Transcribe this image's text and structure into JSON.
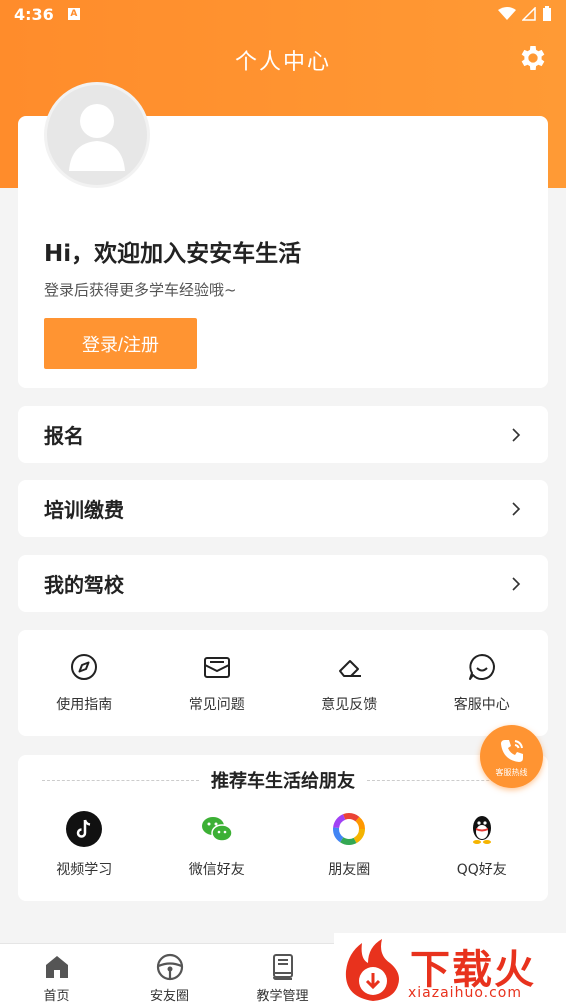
{
  "status_bar": {
    "time": "4:36",
    "notif_letter": "A"
  },
  "header": {
    "title": "个人中心"
  },
  "profile": {
    "welcome": "Hi，欢迎加入安安车生活",
    "subtext": "登录后获得更多学车经验哦~",
    "login_label": "登录/注册"
  },
  "menu": [
    {
      "label": "报名"
    },
    {
      "label": "培训缴费"
    },
    {
      "label": "我的驾校"
    }
  ],
  "quick_actions": [
    {
      "label": "使用指南",
      "icon": "compass-icon"
    },
    {
      "label": "常见问题",
      "icon": "mail-icon"
    },
    {
      "label": "意见反馈",
      "icon": "eraser-icon"
    },
    {
      "label": "客服中心",
      "icon": "chat-icon"
    }
  ],
  "share": {
    "title": "推荐车生活给朋友",
    "items": [
      {
        "label": "视频学习",
        "icon": "tiktok-icon"
      },
      {
        "label": "微信好友",
        "icon": "wechat-icon"
      },
      {
        "label": "朋友圈",
        "icon": "moments-icon"
      },
      {
        "label": "QQ好友",
        "icon": "qq-icon"
      }
    ]
  },
  "hotline": {
    "label": "客服热线"
  },
  "bottom_nav": [
    {
      "label": "首页",
      "icon": "home-icon"
    },
    {
      "label": "安友圈",
      "icon": "steering-wheel-icon"
    },
    {
      "label": "教学管理",
      "icon": "book-icon"
    }
  ],
  "watermark": {
    "text": "下载火",
    "url": "xiazaihuo.com"
  },
  "colors": {
    "accent": "#ff9432",
    "header": "#ff8c2b",
    "watermark": "#e8321d"
  }
}
